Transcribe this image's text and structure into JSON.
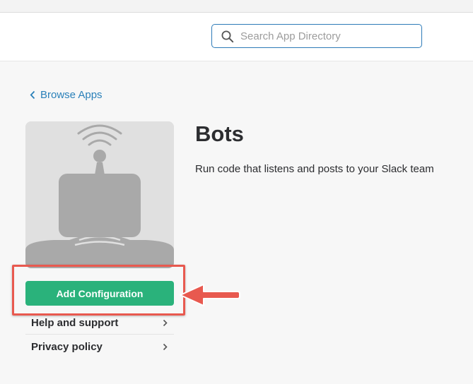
{
  "header": {
    "search": {
      "placeholder": "Search App Directory",
      "value": "",
      "icon": "search-icon"
    }
  },
  "nav": {
    "back_label": "Browse Apps",
    "back_icon": "chevron-left-icon"
  },
  "app": {
    "name": "Bots",
    "description": "Run code that listens and posts to your Slack team",
    "icon": "bot-robot-icon",
    "primary_action": "Add Configuration"
  },
  "side_menu": [
    {
      "label": "Help and support",
      "icon": "chevron-right-icon"
    },
    {
      "label": "Privacy policy",
      "icon": "chevron-right-icon"
    }
  ],
  "annotation": {
    "highlight_color": "#e8594f",
    "pointer": "arrow-left-icon"
  },
  "colors": {
    "accent_green": "#2ab27b",
    "link_blue": "#2a80b9",
    "search_border": "#2d7bb8"
  }
}
